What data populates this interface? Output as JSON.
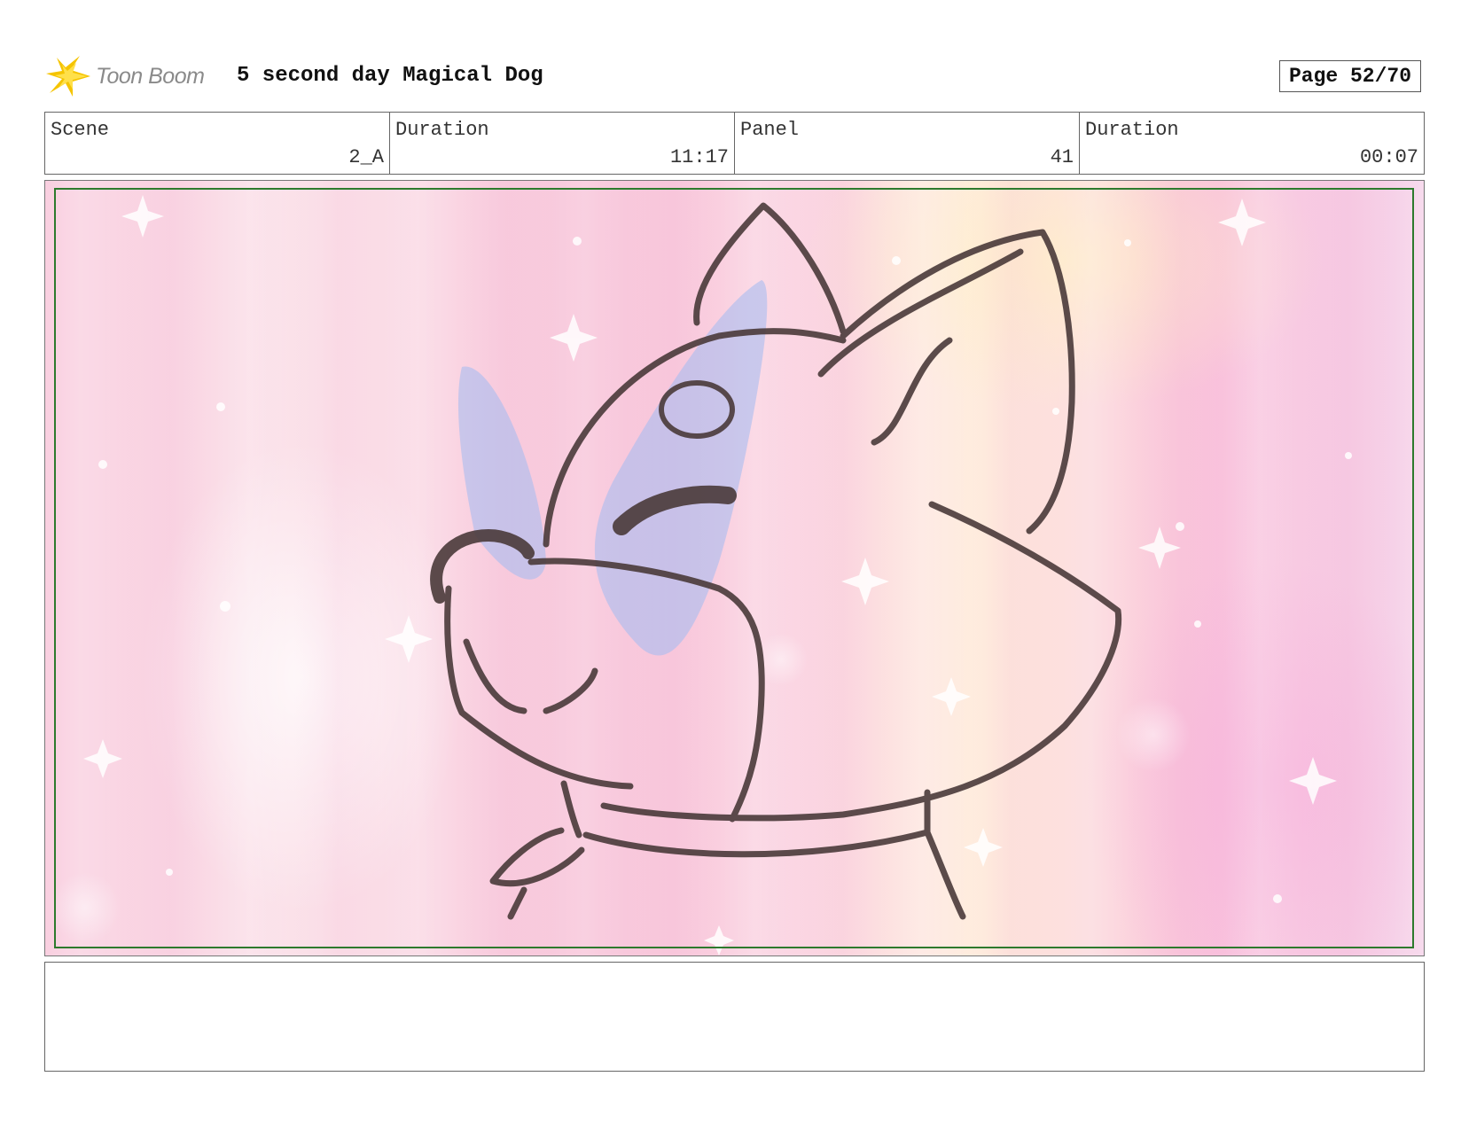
{
  "header": {
    "logo_text": "Toon Boom",
    "project_title": "5 second day Magical Dog",
    "page_label": "Page 52/70"
  },
  "info": {
    "scene_label": "Scene",
    "scene_value": "2_A",
    "scene_duration_label": "Duration",
    "scene_duration_value": "11:17",
    "panel_label": "Panel",
    "panel_value": "41",
    "panel_duration_label": "Duration",
    "panel_duration_value": "00:07"
  },
  "panel": {
    "image_subject": "storyboard sketch of a dog's head on a sparkly pink background"
  },
  "colors": {
    "safe_frame": "#2d7a2d",
    "line_art": "#4a3a3a",
    "logo_yellow": "#f5c400"
  }
}
